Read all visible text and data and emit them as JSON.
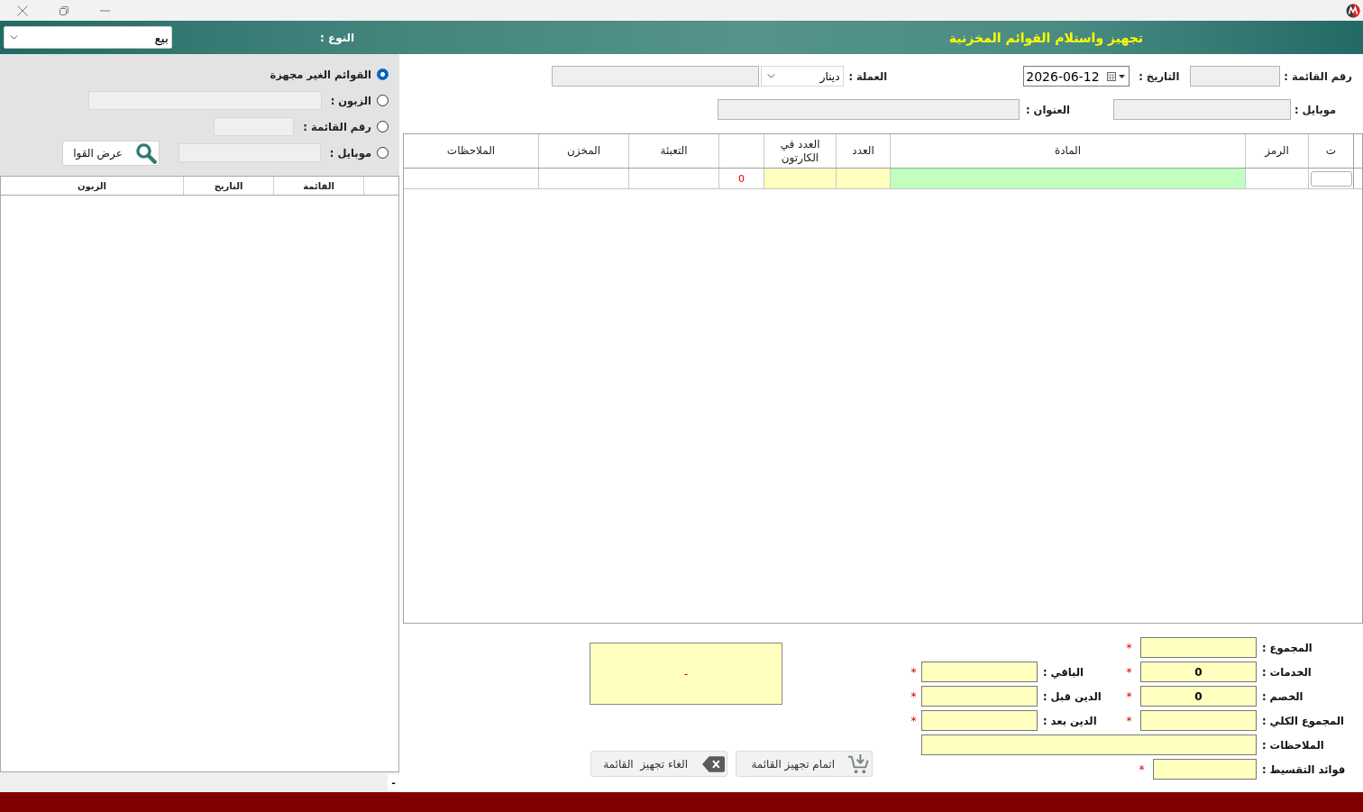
{
  "header": {
    "title": "تجهيز واستلام القوائم المخزنية",
    "type_label": "النوع :",
    "type_value": "بيع"
  },
  "filter_panel": {
    "options": [
      {
        "label": "القوائم الغير مجهزة",
        "selected": true,
        "kind": "plain"
      },
      {
        "label": "الزبون :",
        "selected": false,
        "kind": "field"
      },
      {
        "label": "رقم القائمة :",
        "selected": false,
        "kind": "field"
      },
      {
        "label": "موبايل :",
        "selected": false,
        "kind": "field"
      }
    ],
    "search_button": "عرض القوا"
  },
  "list_table": {
    "columns": [
      "القائمة",
      "التاريخ",
      "الزبون"
    ]
  },
  "list_status": "-",
  "invoice_header": {
    "invoice_number_label": "رقم القائمة :",
    "date_label": "التاريخ :",
    "date_value": "2026-06-12",
    "currency_label": "العملة :",
    "currency_value": "دينار",
    "mobile_label": "موبايل :",
    "address_label": "العنوان :"
  },
  "items_table": {
    "columns": [
      {
        "label": "ت",
        "kind": "row_number"
      },
      {
        "label": "الرمز",
        "kind": "plain"
      },
      {
        "label": "المادة",
        "kind": "item"
      },
      {
        "label": "العدد",
        "kind": "quantity"
      },
      {
        "label": "العدد في الكارتون",
        "kind": "quantity"
      },
      {
        "kind": "total"
      },
      {
        "label": "التعبئة",
        "kind": "plain"
      },
      {
        "label": "المخزن",
        "kind": "plain"
      },
      {
        "label": "الملاحظات",
        "kind": "plain"
      }
    ],
    "rows": [
      {
        "total": "0"
      }
    ]
  },
  "totals": {
    "rows": [
      {
        "fields": [
          {
            "label": "المجموع :",
            "kind": "amount",
            "mark": "*"
          }
        ]
      },
      {
        "fields": [
          {
            "label": "الخدمات :",
            "kind": "amount",
            "value": "0",
            "mark": "*"
          },
          {
            "label": "الباقي :",
            "kind": "amount",
            "mark": "*"
          }
        ]
      },
      {
        "fields": [
          {
            "label": "الخصم :",
            "kind": "amount",
            "value": "0",
            "mark": "*"
          },
          {
            "label": "الدين قبل :",
            "kind": "amount",
            "mark": "*"
          }
        ]
      },
      {
        "fields": [
          {
            "label": "المجموع الكلي :",
            "kind": "amount",
            "mark": "*"
          },
          {
            "label": "الدين بعد :",
            "kind": "amount",
            "mark": "*"
          }
        ]
      },
      {
        "fields": [
          {
            "label": "الملاحظات :",
            "kind": "wide"
          }
        ]
      },
      {
        "fields": [
          {
            "label": "فوائد التقسيط :",
            "kind": "short",
            "mark": "*"
          }
        ]
      }
    ]
  },
  "message": "-",
  "buttons": [
    {
      "label": "اتمام تجهيز القائمة",
      "kind": "complete"
    },
    {
      "label": "الغاء تجهيز  القائمة",
      "kind": "cancel"
    }
  ]
}
